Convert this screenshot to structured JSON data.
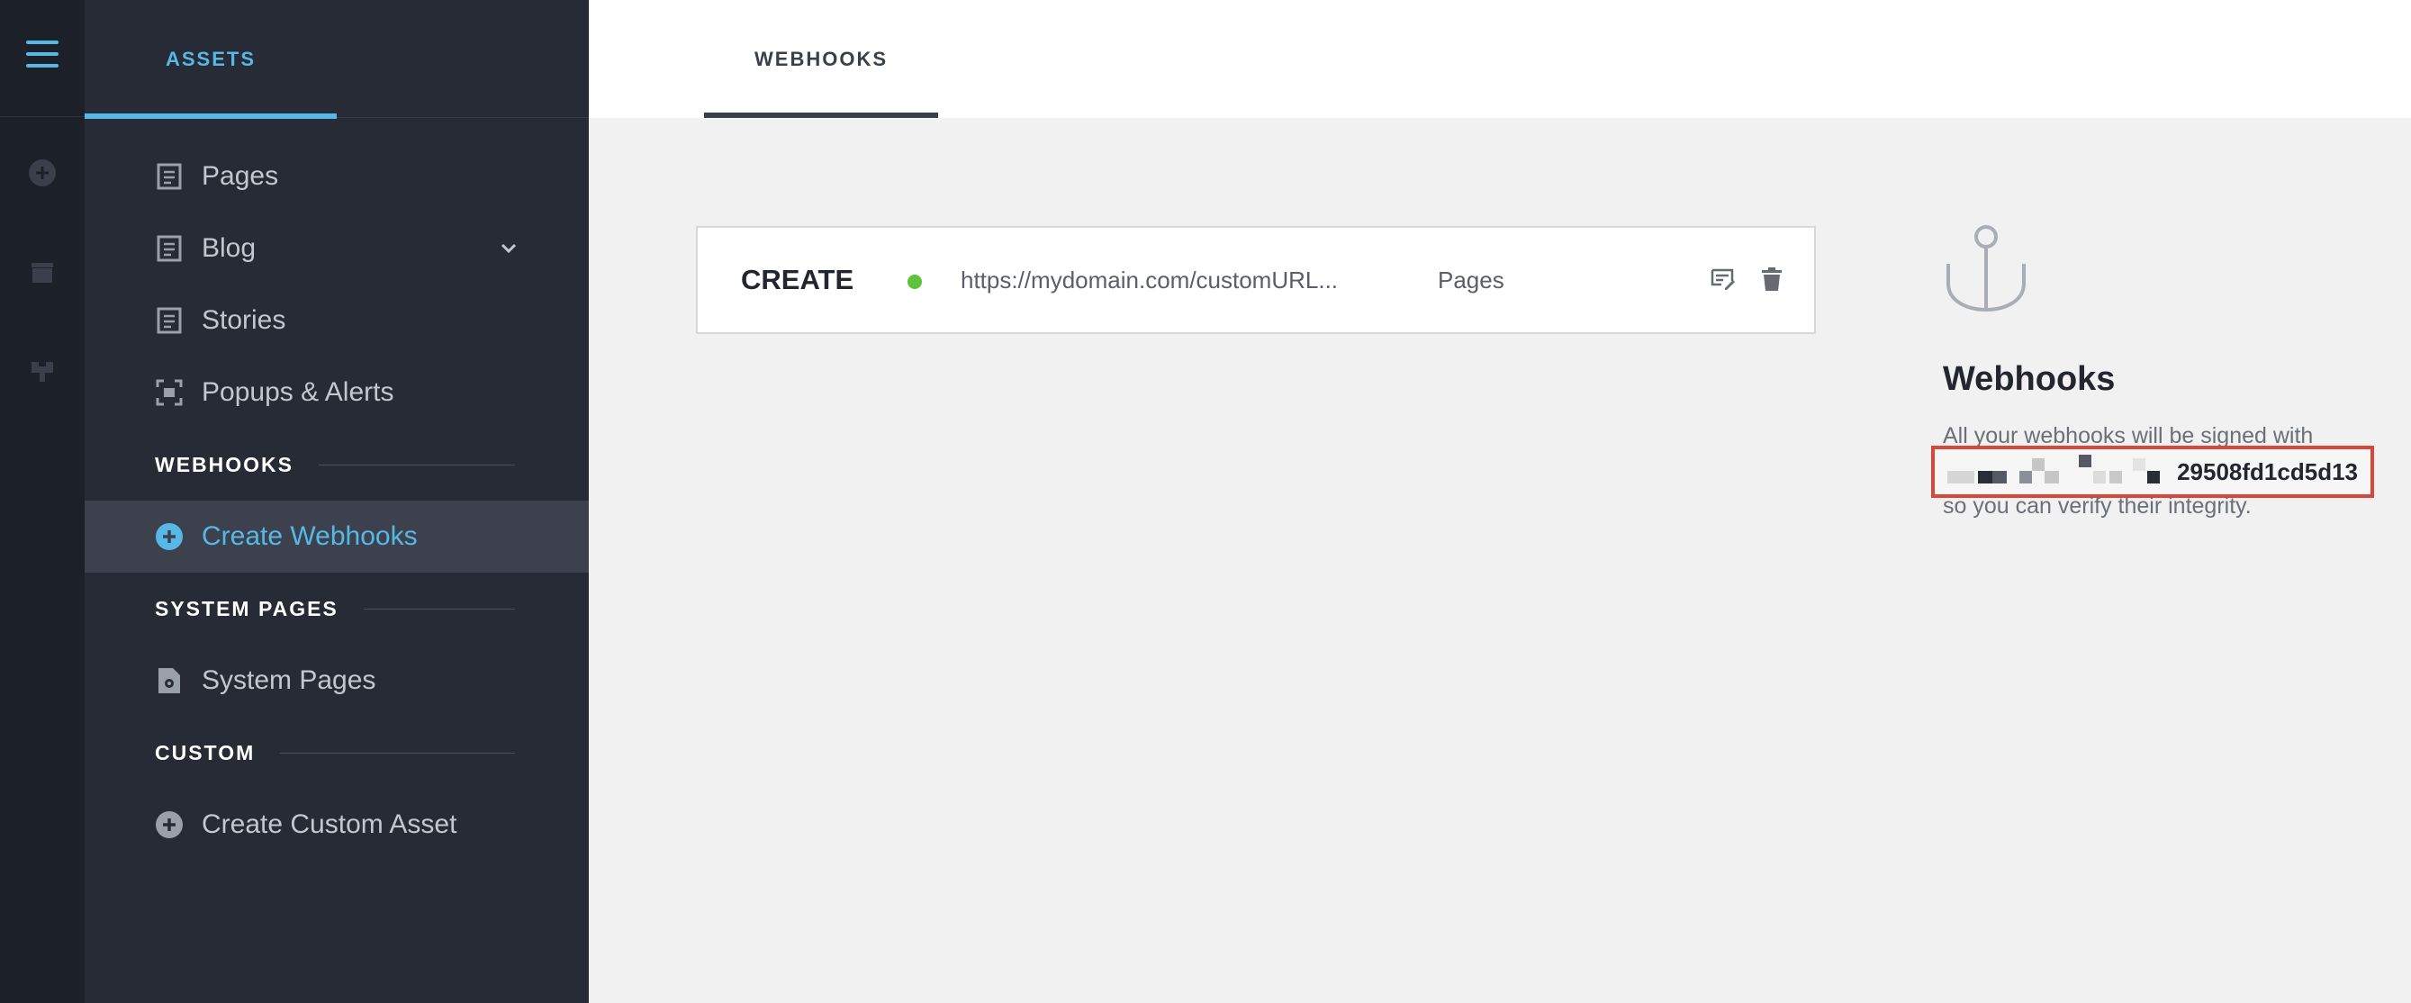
{
  "rail": {
    "icons": [
      "menu-icon",
      "plus-circle-icon",
      "box-icon",
      "plugin-icon"
    ]
  },
  "sidebar": {
    "tab_label": "ASSETS",
    "items": [
      {
        "label": "Pages",
        "icon": "page-icon"
      },
      {
        "label": "Blog",
        "icon": "page-icon"
      },
      {
        "label": "Stories",
        "icon": "page-icon"
      },
      {
        "label": "Popups & Alerts",
        "icon": "popup-icon"
      }
    ],
    "sections": {
      "webhooks": "WEBHOOKS",
      "system_pages": "SYSTEM PAGES",
      "custom": "CUSTOM"
    },
    "create_webhooks": "Create Webhooks",
    "system_pages_item": "System Pages",
    "create_custom_asset": "Create Custom Asset"
  },
  "topbar": {
    "tab_label": "WEBHOOKS"
  },
  "webhook": {
    "method": "CREATE",
    "status_color": "#5cc33a",
    "url": "https://mydomain.com/customURL...",
    "scope": "Pages"
  },
  "info": {
    "title": "Webhooks",
    "line1": "All your webhooks will be signed with",
    "key_suffix": "29508fd1cd5d13",
    "line3": "so you can verify their integrity."
  },
  "colors": {
    "accent": "#56b8e6",
    "highlight_box": "#d8473a"
  }
}
